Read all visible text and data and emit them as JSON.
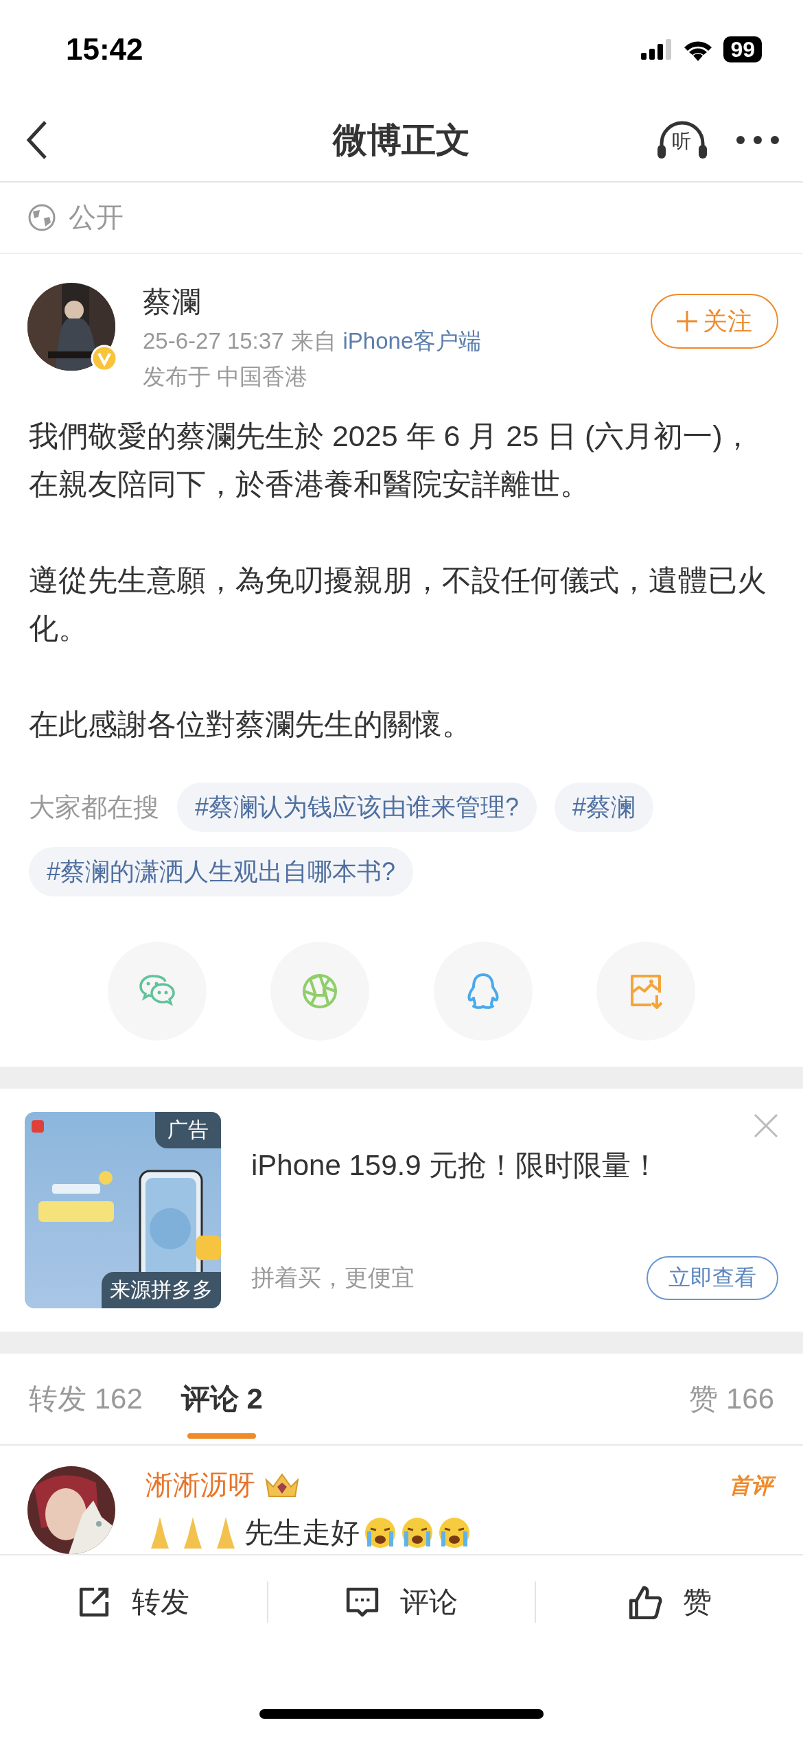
{
  "status_bar": {
    "time": "15:42",
    "battery": "99"
  },
  "nav": {
    "title": "微博正文",
    "listen_label": "听"
  },
  "visibility": {
    "label": "公开"
  },
  "post": {
    "author": "蔡瀾",
    "verified": true,
    "time": "25-6-27 15:37",
    "source_prefix": "来自",
    "source": "iPhone客户端",
    "location": "发布于 中国香港",
    "follow_button": "关注",
    "paragraphs": [
      "我們敬愛的蔡瀾先生於 2025 年 6 月 25 日 (六月初一)，在親友陪同下，於香港養和醫院安詳離世。",
      "遵從先生意願，為免叨擾親朋，不設任何儀式，遺體已火化。",
      "在此感謝各位對蔡瀾先生的關懷。"
    ]
  },
  "hot_search": {
    "label": "大家都在搜",
    "tags": [
      "#蔡澜认为钱应该由谁来管理?",
      "#蔡澜",
      "#蔡澜的潇洒人生观出自哪本书?"
    ]
  },
  "share": [
    {
      "kind": "wechat"
    },
    {
      "kind": "moments"
    },
    {
      "kind": "qq"
    },
    {
      "kind": "save_image"
    }
  ],
  "ad": {
    "badge": "广告",
    "source": "来源拼多多",
    "title": "iPhone 159.9 元抢！限时限量！",
    "subtitle": "拼着买，更便宜",
    "button": "立即查看"
  },
  "tabs": [
    {
      "label": "转发 162",
      "selected": false
    },
    {
      "label": "评论 2",
      "selected": true
    },
    {
      "label": "赞 166",
      "selected": false
    }
  ],
  "comments": [
    {
      "user": "淅淅沥呀",
      "badge": "首评",
      "text": "先生走好"
    }
  ],
  "bottom_bar": [
    {
      "kind": "repost",
      "label": "转发"
    },
    {
      "kind": "comment",
      "label": "评论"
    },
    {
      "kind": "like",
      "label": "赞"
    }
  ]
}
